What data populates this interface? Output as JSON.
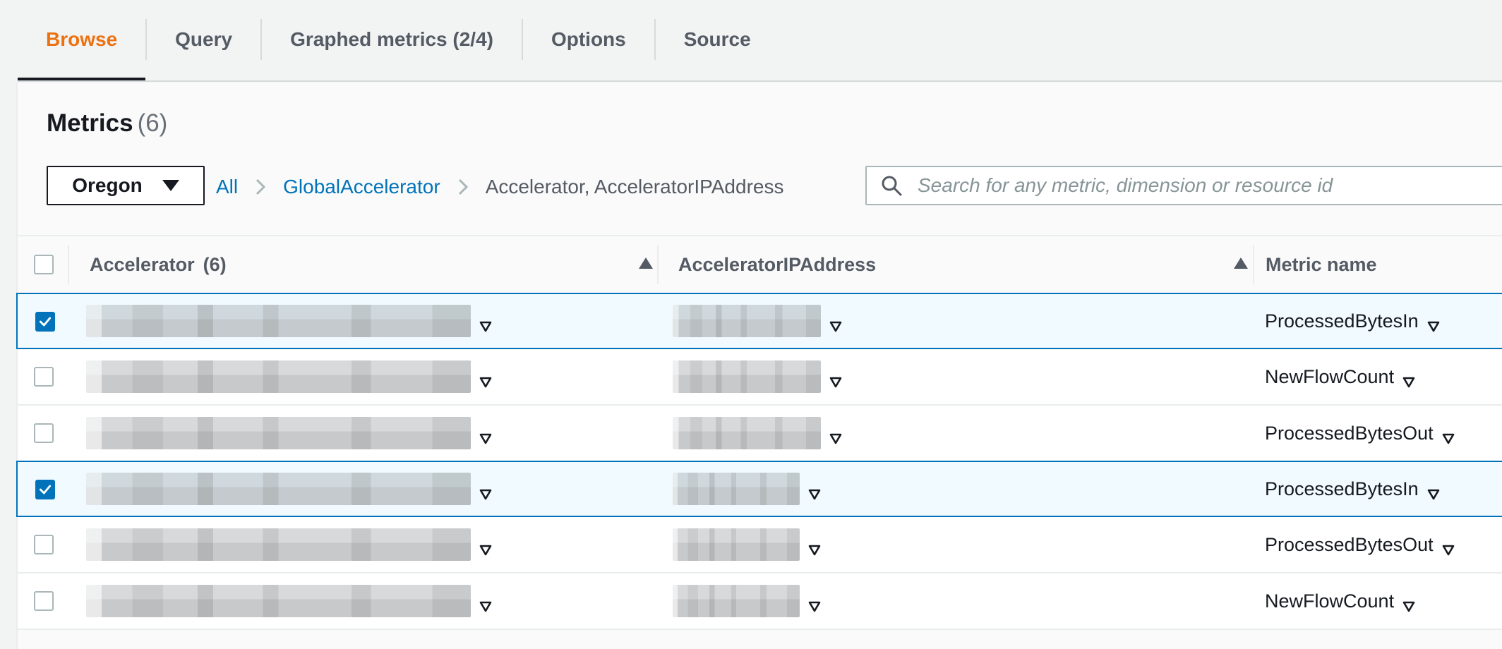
{
  "tabs": [
    {
      "label": "Browse",
      "active": true
    },
    {
      "label": "Query"
    },
    {
      "label": "Graphed metrics (2/4)"
    },
    {
      "label": "Options"
    },
    {
      "label": "Source"
    }
  ],
  "header": {
    "title": "Metrics",
    "count": "(6)"
  },
  "region": {
    "label": "Oregon"
  },
  "breadcrumb": {
    "all": "All",
    "namespace": "GlobalAccelerator",
    "current": "Accelerator, AcceleratorIPAddress"
  },
  "search": {
    "placeholder": "Search for any metric, dimension or resource id"
  },
  "columns": {
    "accelerator": "Accelerator",
    "accelerator_count": "(6)",
    "ip": "AcceleratorIPAddress",
    "metric": "Metric name"
  },
  "rows": [
    {
      "checked": true,
      "metric": "ProcessedBytesIn"
    },
    {
      "checked": false,
      "metric": "NewFlowCount"
    },
    {
      "checked": false,
      "metric": "ProcessedBytesOut"
    },
    {
      "checked": true,
      "metric": "ProcessedBytesIn"
    },
    {
      "checked": false,
      "metric": "ProcessedBytesOut"
    },
    {
      "checked": false,
      "metric": "NewFlowCount"
    }
  ],
  "colors": {
    "accent": "#ec7211",
    "link": "#0073bb",
    "selected_bg": "#f1faff"
  }
}
